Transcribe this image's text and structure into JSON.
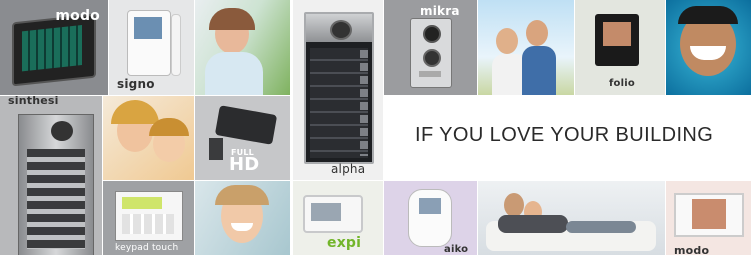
{
  "banner": {
    "tagline": "IF YOU LOVE YOUR BUILDING",
    "products": {
      "modo": "modo",
      "signo": "signo",
      "sinthesi": "sinthesi",
      "hd": "HD",
      "hd_full": "FULL",
      "alpha": "alpha",
      "mikra": "mikra",
      "folio": "folio",
      "keypad": "keypad touch",
      "expi": "expi",
      "aiko": "aiko",
      "modo2": "modo"
    }
  }
}
